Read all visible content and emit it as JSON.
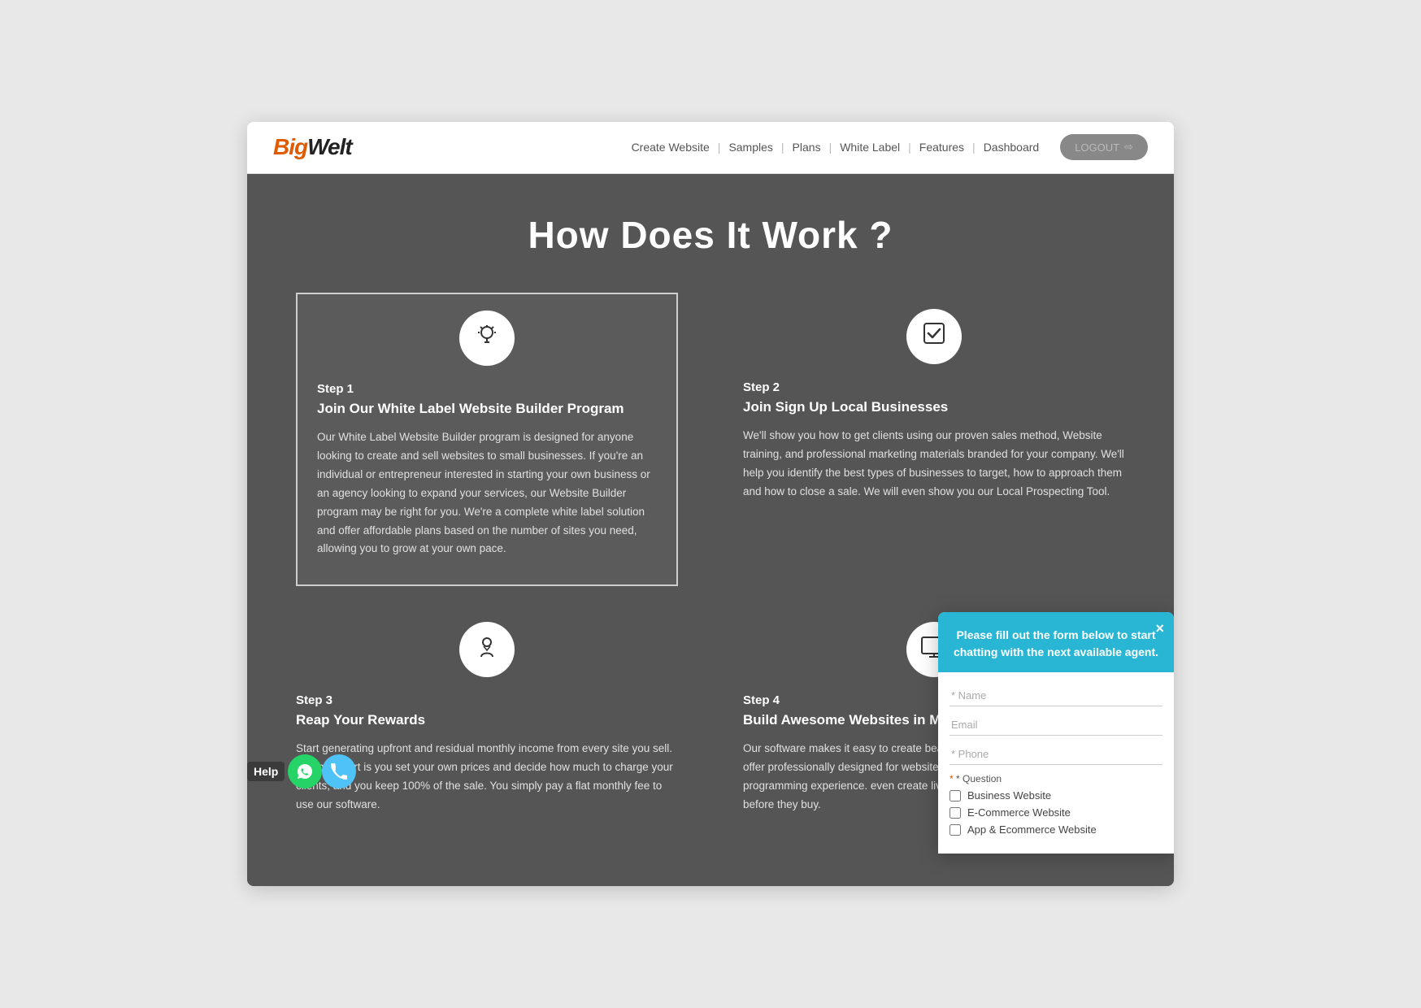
{
  "header": {
    "logo_big": "Big",
    "logo_welt": "Welt",
    "nav": {
      "create_website": "Create Website",
      "samples": "Samples",
      "plans": "Plans",
      "white_label": "White Label",
      "features": "Features",
      "dashboard": "Dashboard"
    },
    "logout_label": "LOGOUT"
  },
  "hero": {
    "title": "How Does It Work ?",
    "step1": {
      "number": "Step 1",
      "heading": "Join Our White Label Website Builder Program",
      "text": "Our White Label Website Builder program is designed for anyone looking to create and sell websites to small businesses. If you're an individual or entrepreneur interested in starting your own business or an agency looking to expand your services, our Website Builder program may be right for you. We're a complete white label solution and offer affordable plans based on the number of sites you need, allowing you to grow at your own pace.",
      "icon": "💡"
    },
    "step2": {
      "number": "Step 2",
      "heading": "Join Sign Up Local Businesses",
      "text": "We'll show you how to get clients using our proven sales method, Website training, and professional marketing materials branded for your company. We'll help you identify the best types of businesses to target, how to approach them and how to close a sale. We will even show you our Local Prospecting Tool.",
      "icon": "✔"
    },
    "step3": {
      "number": "Step 3",
      "heading": "Reap Your Rewards",
      "text": "Start generating upfront and residual monthly income from every site you sell. The best part is you set your own prices and decide how much to charge your clients, and you keep 100% of the sale. You simply pay a flat monthly fee to use our software.",
      "icon": "🏅"
    },
    "step4": {
      "number": "Step 4",
      "heading": "Build Awesome Websites in Minutes",
      "text": "Our software makes it easy to create beautiful websites for any business. We offer professionally designed for website builder requires no coding, no programming experience. even create live demo sites in minutes allowing site before they buy.",
      "icon": "💻"
    }
  },
  "help": {
    "label": "Help"
  },
  "chat": {
    "header_text": "Please fill out the form below to start chatting with the next available agent.",
    "close_label": "×",
    "name_placeholder": "* Name",
    "email_placeholder": "Email",
    "phone_placeholder": "* Phone",
    "question_label": "* Question",
    "options": [
      "Business Website",
      "E-Commerce Website",
      "App & Ecommerce Website"
    ]
  }
}
